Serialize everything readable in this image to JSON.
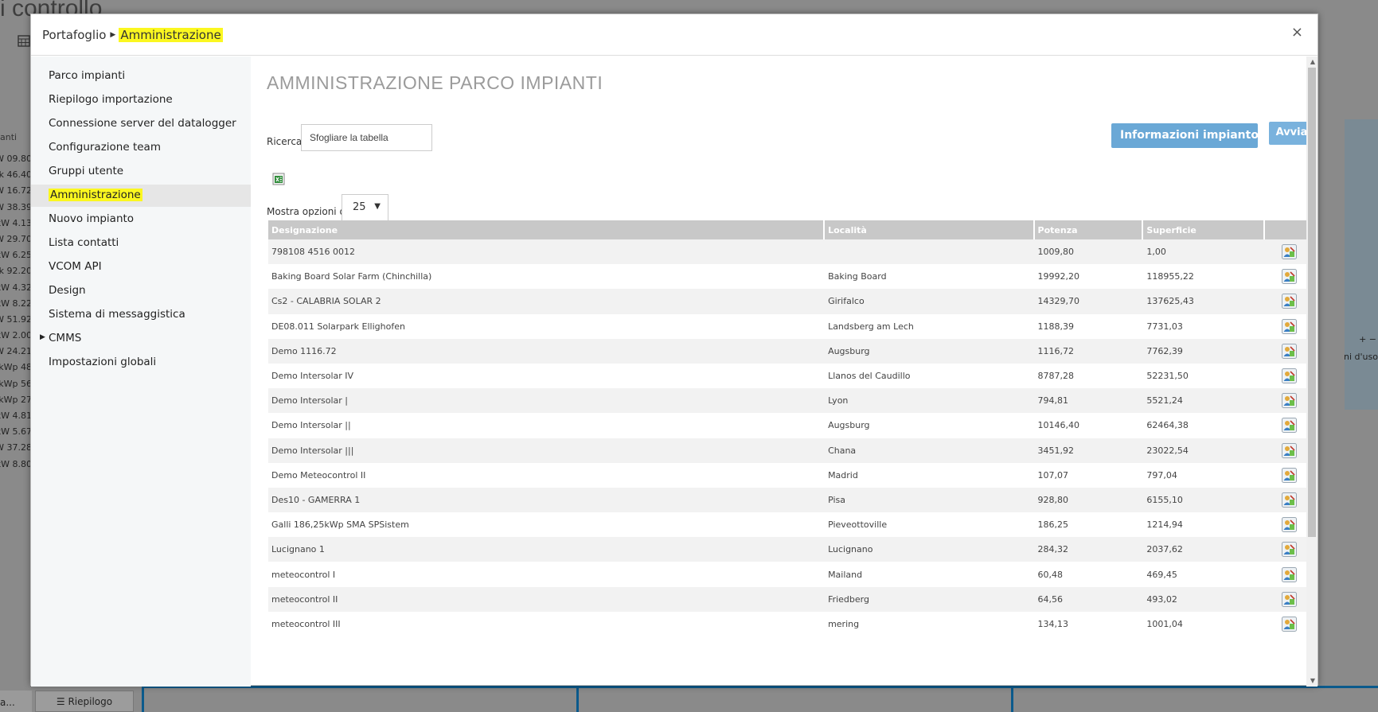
{
  "background": {
    "title": "i controllo",
    "column_header": "anti",
    "values": [
      "09.80 kW",
      "46.40 k",
      "16.72 kW",
      "38.39 kW",
      "4.13 kW",
      "29.70 kW",
      "6.25 kW",
      "92.20 k",
      "4.32 kW",
      "8.22 kW",
      "51.92 kW",
      "2.00 kW",
      "24.21 kW",
      "48 kWp",
      "56 kWp",
      "27 kWp",
      "4.81 kW",
      "5.67 kW",
      "37.28 kW",
      "8.80 kW"
    ],
    "map_controls": "+ −",
    "map_text": "ni d'uso",
    "bottom_tab_left": "a...",
    "bottom_tab": "Riepilogo"
  },
  "modal": {
    "breadcrumb": {
      "root": "Portafoglio",
      "current": "Amministrazione"
    },
    "close": "×"
  },
  "sidebar": {
    "items": [
      {
        "label": "Parco impianti"
      },
      {
        "label": "Riepilogo importazione"
      },
      {
        "label": "Connessione server del datalogger"
      },
      {
        "label": "Configurazione team"
      },
      {
        "label": "Gruppi utente"
      },
      {
        "label": "Amministrazione"
      },
      {
        "label": "Nuovo impianto"
      },
      {
        "label": "Lista contatti"
      },
      {
        "label": "VCOM API"
      },
      {
        "label": "Design"
      },
      {
        "label": "Sistema di messaggistica"
      },
      {
        "label": "CMMS"
      },
      {
        "label": "Impostazioni globali"
      }
    ]
  },
  "main": {
    "title": "AMMINISTRAZIONE PARCO IMPIANTI",
    "search_label": "Ricerca",
    "search_value": "Sfogliare la tabella",
    "info_button": "Informazioni impianto",
    "start_button": "Avvia",
    "show_label": "Mostra opzioni di",
    "show_value": "25",
    "columns": [
      "Designazione",
      "Località",
      "Potenza",
      "Superficie",
      ""
    ],
    "rows": [
      {
        "name": "798108 4516 0012",
        "location": "",
        "power": "1009,80",
        "area": "1,00"
      },
      {
        "name": "Baking Board Solar Farm (Chinchilla)",
        "location": "Baking Board",
        "power": "19992,20",
        "area": "118955,22"
      },
      {
        "name": "Cs2 - CALABRIA SOLAR 2",
        "location": "Girifalco",
        "power": "14329,70",
        "area": "137625,43"
      },
      {
        "name": "DE08.011 Solarpark Ellighofen",
        "location": "Landsberg am Lech",
        "power": "1188,39",
        "area": "7731,03"
      },
      {
        "name": "Demo 1116.72",
        "location": "Augsburg",
        "power": "1116,72",
        "area": "7762,39"
      },
      {
        "name": "Demo Intersolar IV",
        "location": "Llanos del Caudillo",
        "power": "8787,28",
        "area": "52231,50"
      },
      {
        "name": "Demo Intersolar |",
        "location": "Lyon",
        "power": "794,81",
        "area": "5521,24"
      },
      {
        "name": "Demo Intersolar ||",
        "location": "Augsburg",
        "power": "10146,40",
        "area": "62464,38"
      },
      {
        "name": "Demo Intersolar |||",
        "location": "Chana",
        "power": "3451,92",
        "area": "23022,54"
      },
      {
        "name": "Demo Meteocontrol II",
        "location": "Madrid",
        "power": "107,07",
        "area": "797,04"
      },
      {
        "name": "Des10 - GAMERRA 1",
        "location": "Pisa",
        "power": "928,80",
        "area": "6155,10"
      },
      {
        "name": "Galli 186,25kWp SMA SPSistem",
        "location": "Pieveottoville",
        "power": "186,25",
        "area": "1214,94"
      },
      {
        "name": "Lucignano 1",
        "location": "Lucignano",
        "power": "284,32",
        "area": "2037,62"
      },
      {
        "name": "meteocontrol I",
        "location": "Mailand",
        "power": "60,48",
        "area": "469,45"
      },
      {
        "name": "meteocontrol II",
        "location": "Friedberg",
        "power": "64,56",
        "area": "493,02"
      },
      {
        "name": "meteocontrol III",
        "location": "mering",
        "power": "134,13",
        "area": "1001,04"
      }
    ]
  },
  "colors": {
    "highlight": "#fbf720",
    "button": "#6aa8d6",
    "header_bg": "#c8c8c8"
  }
}
